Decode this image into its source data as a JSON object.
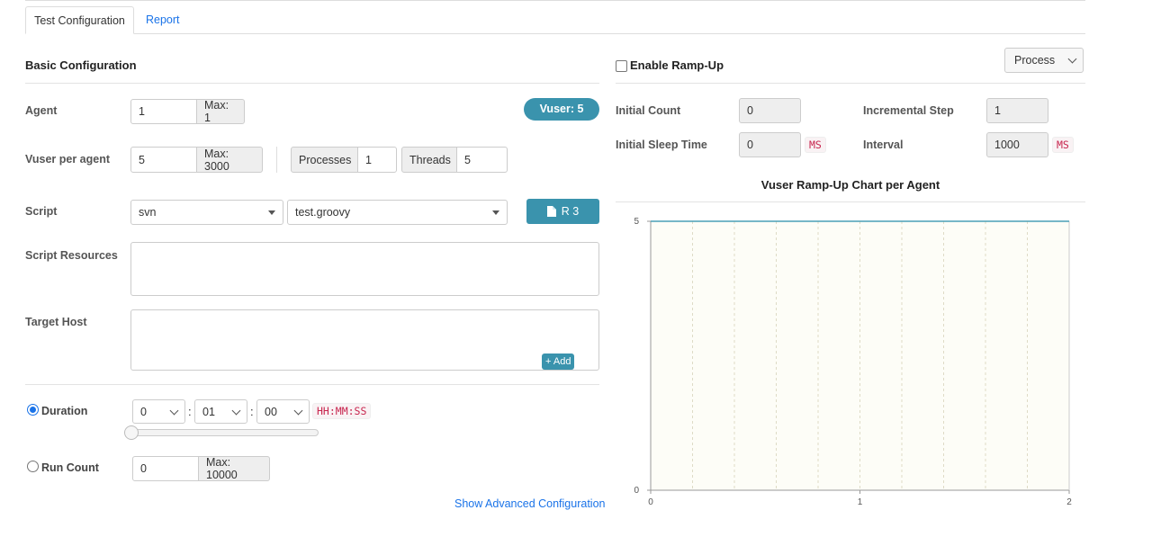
{
  "tabs": {
    "config_label": "Test Configuration",
    "report_label": "Report"
  },
  "basic": {
    "title": "Basic Configuration",
    "agent_label": "Agent",
    "agent_value": "1",
    "agent_max": "Max: 1",
    "vuser_badge": "Vuser: 5",
    "vuser_per_agent_label": "Vuser per agent",
    "vuser_per_agent_value": "5",
    "vuser_max": "Max: 3000",
    "processes_label": "Processes",
    "processes_value": "1",
    "threads_label": "Threads",
    "threads_value": "5",
    "script_label": "Script",
    "script_repo": "svn",
    "script_file": "test.groovy",
    "revision_button": "R 3",
    "script_resources_label": "Script Resources",
    "target_host_label": "Target Host",
    "add_button": "Add",
    "duration_label": "Duration",
    "duration_hours": "0",
    "duration_minutes": "01",
    "duration_seconds": "00",
    "duration_sep": ":",
    "duration_format": "HH:MM:SS",
    "duration_slider_fraction": 0,
    "run_count_label": "Run Count",
    "run_count_value": "0",
    "run_count_max": "Max: 10000",
    "advanced_link": "Show Advanced Configuration",
    "duration_selected": true
  },
  "rampup": {
    "enable_label": "Enable Ramp-Up",
    "enabled": false,
    "type_select": "Process",
    "initial_count_label": "Initial Count",
    "initial_count_value": "0",
    "incremental_step_label": "Incremental Step",
    "incremental_step_value": "1",
    "initial_sleep_label": "Initial Sleep Time",
    "initial_sleep_value": "0",
    "initial_sleep_unit": "MS",
    "interval_label": "Interval",
    "interval_value": "1000",
    "interval_unit": "MS"
  },
  "colors": {
    "accent": "#3a93ad",
    "link": "#1a73e8",
    "chart_line": "#4a9fb5",
    "chart_bg": "#fdfdf7"
  },
  "chart_data": {
    "type": "line",
    "title": "Vuser Ramp-Up Chart per Agent",
    "xlabel": "",
    "ylabel": "",
    "x_ticks": [
      "0",
      "1",
      "2"
    ],
    "y_ticks": [
      "0",
      "5"
    ],
    "xlim": [
      0,
      2
    ],
    "ylim": [
      0,
      5
    ],
    "grid": "vertical dashed",
    "series": [
      {
        "x": [
          0,
          2
        ],
        "y": [
          5,
          5
        ]
      }
    ]
  }
}
